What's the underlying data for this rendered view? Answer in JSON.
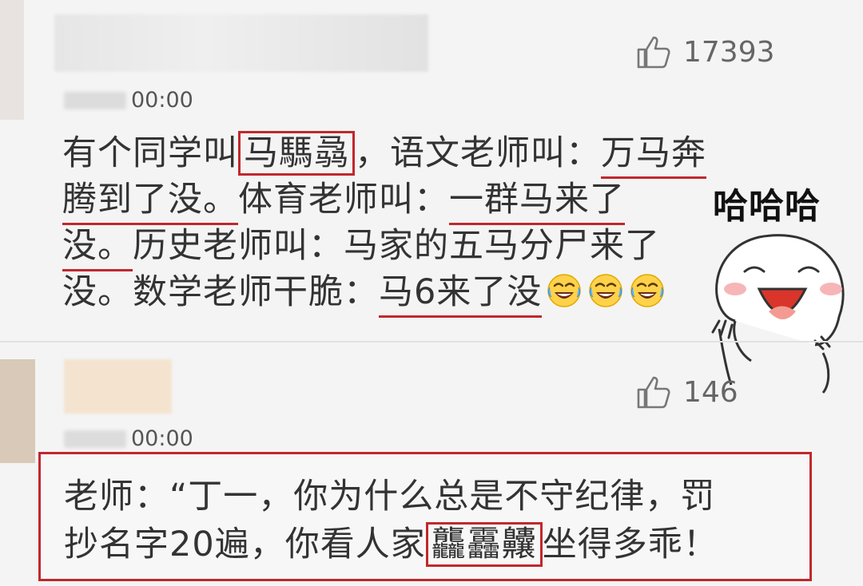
{
  "comments": [
    {
      "time": "00:00",
      "likes": "17393",
      "lines": [
        [
          "有个同学叫",
          {
            "boxed": "马騳骉"
          },
          "，语文老师叫：",
          {
            "underlined": "万马奔"
          }
        ],
        [
          {
            "underlined": "腾到了没。"
          },
          "体育老师叫：",
          {
            "underlined": "一群马来了"
          }
        ],
        [
          {
            "underlined": "没。"
          },
          "历史老师叫：马家的五马分尸来了"
        ],
        [
          "没。数学老师干脆：",
          {
            "underlined": "马6来了没"
          }
        ]
      ],
      "emoji_name": "laugh-cry-emoji",
      "emoji_count": 3
    },
    {
      "time": "00:00",
      "likes": "146",
      "lines": [
        [
          "老师：“丁一，你为什么总是不守纪律，罚"
        ],
        [
          "抄名字20遍，你看人家",
          {
            "boxed": "龘靐齉"
          },
          "坐得多乖！"
        ]
      ]
    }
  ],
  "sticker": {
    "caption": "哈哈哈",
    "icon": "laughing-bun-sticker"
  },
  "colors": {
    "highlight_red": "#c0282d",
    "text": "#333333",
    "background": "#f4f4f4"
  }
}
